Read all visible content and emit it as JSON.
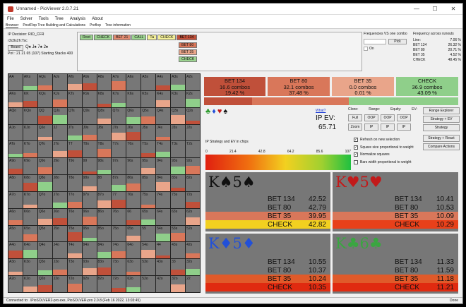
{
  "window": {
    "title": "Unnamed - PioViewer 2.0.7.21",
    "min": "—",
    "max": "☐",
    "close": "✕"
  },
  "menu": [
    "File",
    "Solver",
    "Tools",
    "Tree",
    "Analysis",
    "About"
  ],
  "tabs": [
    "Browser",
    "PostFlop Tree Building and Calculations",
    "Preflop",
    "Tree information"
  ],
  "left_info": {
    "decision": "IP Decision:  RID_CFR",
    "board_cards": "r3c8s2h:Tsc",
    "board_btn": "Board",
    "pot": "Pot : 21 21 65 (107) Starting Stacks 400"
  },
  "tree_row1": [
    "Root",
    "CHECK",
    "BET 21",
    "CALL",
    "T♠",
    "CHECK",
    "BET 134"
  ],
  "tree_col": [
    "BET 80",
    "BET 35",
    "CHECK"
  ],
  "freq_vs": {
    "title": "Frequencies VS one combo",
    "pick": "Pick",
    "on": "On"
  },
  "freq_runouts": {
    "title": "Frequency across runouts",
    "labels": [
      "Line:",
      "BET 134",
      "BET 80",
      "BET 35",
      "CHECK"
    ],
    "values": [
      "7.06 %",
      "26.32 %",
      "20.71 %",
      "4.52 %",
      "48.45 %"
    ]
  },
  "grid_labels": [
    [
      "AA",
      "AKs",
      "AQs",
      "AJs",
      "ATs",
      "A9s",
      "A8s",
      "A7s",
      "A6s",
      "A5s",
      "A4s",
      "A3s",
      "A2s"
    ],
    [
      "AKo",
      "KK",
      "KQs",
      "KJs",
      "KTs",
      "K9s",
      "K8s",
      "K7s",
      "K6s",
      "K5s",
      "K4s",
      "K3s",
      "K2s"
    ],
    [
      "AQo",
      "KQo",
      "QQ",
      "QJs",
      "QTs",
      "Q9s",
      "Q8s",
      "Q7s",
      "Q6s",
      "Q5s",
      "Q4s",
      "Q3s",
      "Q2s"
    ],
    [
      "AJo",
      "KJo",
      "QJo",
      "JJ",
      "JTs",
      "J9s",
      "J8s",
      "J7s",
      "J6s",
      "J5s",
      "J4s",
      "J3s",
      "J2s"
    ],
    [
      "ATo",
      "KTo",
      "QTo",
      "JTo",
      "TT",
      "T9s",
      "T8s",
      "T7s",
      "T6s",
      "T5s",
      "T4s",
      "T3s",
      "T2s"
    ],
    [
      "A9o",
      "K9o",
      "Q9o",
      "J9o",
      "T9o",
      "99",
      "98s",
      "97s",
      "96s",
      "95s",
      "94s",
      "93s",
      "92s"
    ],
    [
      "A8o",
      "K8o",
      "Q8o",
      "J8o",
      "T8o",
      "98o",
      "88",
      "87s",
      "86s",
      "85s",
      "84s",
      "83s",
      "82s"
    ],
    [
      "A7o",
      "K7o",
      "Q7o",
      "J7o",
      "T7o",
      "97o",
      "87o",
      "77",
      "76s",
      "75s",
      "74s",
      "73s",
      "72s"
    ],
    [
      "A6o",
      "K6o",
      "Q6o",
      "J6o",
      "T6o",
      "96o",
      "86o",
      "76o",
      "66",
      "65s",
      "64s",
      "63s",
      "62s"
    ],
    [
      "A5o",
      "K5o",
      "Q5o",
      "J5o",
      "T5o",
      "95o",
      "85o",
      "75o",
      "65o",
      "55",
      "54s",
      "53s",
      "52s"
    ],
    [
      "A4o",
      "K4o",
      "Q4o",
      "J4o",
      "T4o",
      "94o",
      "84o",
      "74o",
      "64o",
      "54o",
      "44",
      "43s",
      "42s"
    ],
    [
      "A3o",
      "K3o",
      "Q3o",
      "J3o",
      "T3o",
      "93o",
      "83o",
      "73o",
      "63o",
      "53o",
      "43o",
      "33",
      "32s"
    ],
    [
      "A2o",
      "K2o",
      "Q2o",
      "J2o",
      "T2o",
      "92o",
      "82o",
      "72o",
      "62o",
      "52o",
      "42o",
      "32o",
      "22"
    ]
  ],
  "strategy": [
    {
      "action": "BET 134",
      "combos": "16.6 combos",
      "pct": "19.42 %",
      "color": "#c0503a"
    },
    {
      "action": "BET 80",
      "combos": "32.1 combos",
      "pct": "37.48 %",
      "color": "#d9775a"
    },
    {
      "action": "BET 35",
      "combos": "0.0 combos",
      "pct": "0.01 %",
      "color": "#e9a58a"
    },
    {
      "action": "CHECK",
      "combos": "36.9 combos",
      "pct": "43.09 %",
      "color": "#8fcf8a"
    }
  ],
  "controls": {
    "what": "What?",
    "ip_ev_label": "IP EV:",
    "ip_ev": "65.71",
    "clone": "Clone:",
    "range": "Range:",
    "equity": "Equity:",
    "ev": "EV:",
    "full": "Full",
    "zoom": "Zoom",
    "oop": "OOP",
    "ip": "IP",
    "range_explorer": "Range Explorer",
    "strategy_ev": "Strategy + EV",
    "strategy_btn": "Strategy",
    "strategy_react": "Strategy + React",
    "compare": "Compare Actions"
  },
  "checkboxes": [
    "Refresh on new selection",
    "Square size proportional to weight",
    "Normalize squares",
    "Bars width proportional to weight"
  ],
  "ev_scale": {
    "title": "IP Strategy and EV in chips",
    "ticks": [
      "0",
      "21.4",
      "42.8",
      "64.2",
      "85.6",
      "107"
    ]
  },
  "cards": [
    {
      "title": "K♠5♠",
      "color": "#111",
      "rows": [
        {
          "a": "BET 134",
          "v": "42.52"
        },
        {
          "a": "BET 80",
          "v": "42.79"
        },
        {
          "a": "BET 35",
          "v": "39.95"
        },
        {
          "a": "CHECK",
          "v": "42.82"
        }
      ]
    },
    {
      "title": "K♥5♥",
      "color": "#c21a1a",
      "rows": [
        {
          "a": "BET 134",
          "v": "10.41"
        },
        {
          "a": "BET 80",
          "v": "10.53"
        },
        {
          "a": "BET 35",
          "v": "10.09"
        },
        {
          "a": "CHECK",
          "v": "10.29"
        }
      ]
    },
    {
      "title": "K♦5♦",
      "color": "#2250d8",
      "rows": [
        {
          "a": "BET 134",
          "v": "10.55"
        },
        {
          "a": "BET 80",
          "v": "10.37"
        },
        {
          "a": "BET 35",
          "v": "10.24"
        },
        {
          "a": "CHECK",
          "v": "10.35"
        }
      ]
    },
    {
      "title": "K♣6♣",
      "color": "#3aa640",
      "rows": [
        {
          "a": "BET 134",
          "v": "11.33"
        },
        {
          "a": "BET 80",
          "v": "11.59"
        },
        {
          "a": "BET 35",
          "v": "11.18"
        },
        {
          "a": "CHECK",
          "v": "11.21"
        }
      ]
    }
  ],
  "status": {
    "left": "Connected to: .\\PioSOLVER2-pro.exe, PioSOLVER-pro 2.0.8 (Feb 16 2022, 13:03:45)",
    "right": "Done"
  }
}
